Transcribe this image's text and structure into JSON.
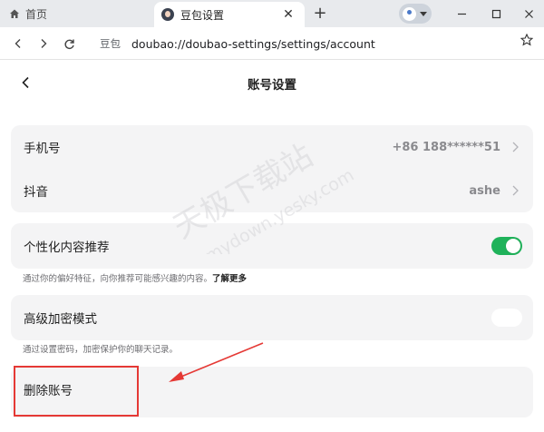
{
  "browser": {
    "tabs": [
      {
        "label": "首页",
        "icon": "home-icon",
        "active": false
      },
      {
        "label": "豆包设置",
        "icon": "doubao-favicon",
        "active": true
      }
    ],
    "new_tab_icon": "plus-icon",
    "address": {
      "site_chip": "豆包",
      "url": "doubao://doubao-settings/settings/account"
    },
    "window_controls": [
      "minimize-icon",
      "maximize-icon",
      "close-icon"
    ]
  },
  "page": {
    "title": "账号设置",
    "account": [
      {
        "label": "手机号",
        "value": "+86 188******51"
      },
      {
        "label": "抖音",
        "value": "ashe"
      }
    ],
    "personalized": {
      "label": "个性化内容推荐",
      "enabled": true,
      "note": "通过你的偏好特征，向你推荐可能感兴趣的内容。",
      "more": "了解更多"
    },
    "encryption": {
      "label": "高级加密模式",
      "enabled": false,
      "note": "通过设置密码，加密保护你的聊天记录。"
    },
    "delete": {
      "label": "删除账号"
    }
  },
  "watermark": {
    "line1": "天极下载站",
    "line2": "mydown.yesky.com"
  },
  "colors": {
    "toggle_on": "#1fb25a",
    "annotation": "#e53935",
    "card_bg": "#f4f4f5"
  }
}
